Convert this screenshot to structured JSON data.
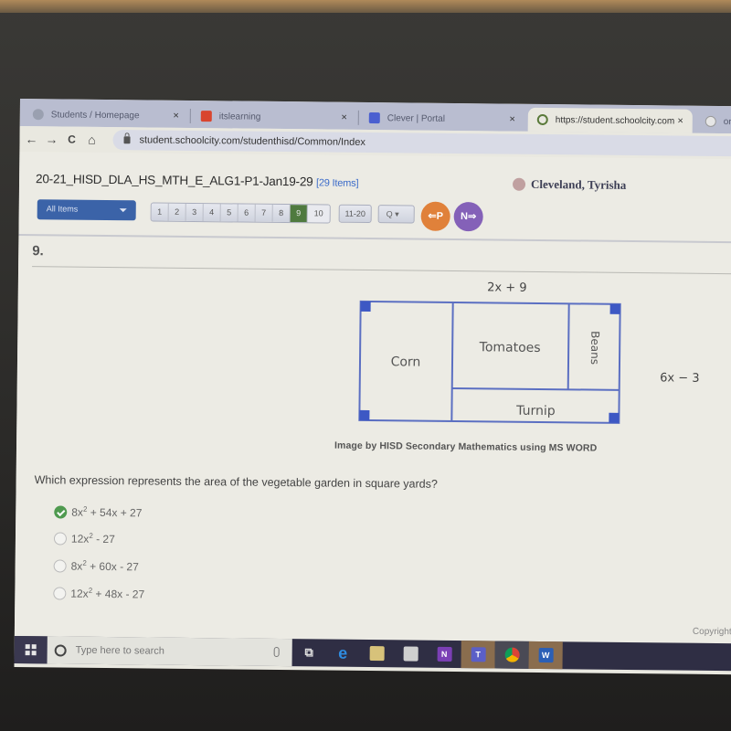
{
  "browser": {
    "tabs": [
      {
        "label": "Students / Homepage",
        "icon": "globe-icon",
        "color": "#9aa0b0"
      },
      {
        "label": "itslearning",
        "icon": "itslearning-icon",
        "color": "#d9452e"
      },
      {
        "label": "Clever | Portal",
        "icon": "clever-icon",
        "color": "#4a5fd0"
      },
      {
        "label": "https://student.schoolcity.com",
        "icon": "loading-icon",
        "color": "#5a7a3a",
        "active": true
      },
      {
        "label": "on",
        "icon": "google-icon",
        "color": "#dddddd"
      }
    ],
    "close_glyph": "×",
    "nav": {
      "back": "←",
      "forward": "→",
      "reload": "C",
      "home": "⌂"
    },
    "url": "student.schoolcity.com/studenthisd/Common/Index"
  },
  "test": {
    "title": "20-21_HISD_DLA_HS_MTH_E_ALG1-P1-Jan19-29",
    "item_count": "[29 Items]",
    "student_name": "Cleveland, Tyrisha",
    "filter_select": "All Items",
    "pages": [
      "1",
      "2",
      "3",
      "4",
      "5",
      "6",
      "7",
      "8",
      "9",
      "10"
    ],
    "current_page": "9",
    "range_button": "11-20",
    "search_button": "Q ▾",
    "prev_button": "⇐P",
    "next_button": "N⇒"
  },
  "question": {
    "number": "9.",
    "diagram": {
      "top_label": "2x + 9",
      "side_label": "6x − 3",
      "regions": [
        "Corn",
        "Tomatoes",
        "Beans",
        "Turnip"
      ],
      "border_color": "#5b6fc2",
      "corner_color": "#3d58c4"
    },
    "caption": "Image by HISD Secondary Mathematics using MS WORD",
    "prompt": "Which expression represents the area of the vegetable garden in square yards?",
    "choices": [
      {
        "base": "8x",
        "exp": "2",
        "rest": " + 54x + 27",
        "selected": true
      },
      {
        "base": "12x",
        "exp": "2",
        "rest": " - 27",
        "selected": false
      },
      {
        "base": "8x",
        "exp": "2",
        "rest": " + 60x - 27",
        "selected": false
      },
      {
        "base": "12x",
        "exp": "2",
        "rest": " + 48x - 27",
        "selected": false
      }
    ],
    "copyright": "Copyright"
  },
  "taskbar": {
    "search_placeholder": "Type here to search",
    "apps": [
      {
        "name": "task-view-icon",
        "glyph": "⧉",
        "color": "transparent"
      },
      {
        "name": "edge-icon",
        "glyph": "e",
        "color": "#2f8ce0"
      },
      {
        "name": "file-explorer-icon",
        "glyph": "",
        "color": "#d7c27a"
      },
      {
        "name": "store-icon",
        "glyph": "",
        "color": "#cfcfcf"
      },
      {
        "name": "onenote-icon",
        "glyph": "N",
        "color": "#7b3fb5"
      },
      {
        "name": "teams-icon",
        "glyph": "T",
        "color": "#5b5fc7"
      },
      {
        "name": "chrome-icon",
        "glyph": "",
        "color": "#e0b040"
      },
      {
        "name": "word-icon",
        "glyph": "W",
        "color": "#2b5fb5"
      }
    ]
  }
}
